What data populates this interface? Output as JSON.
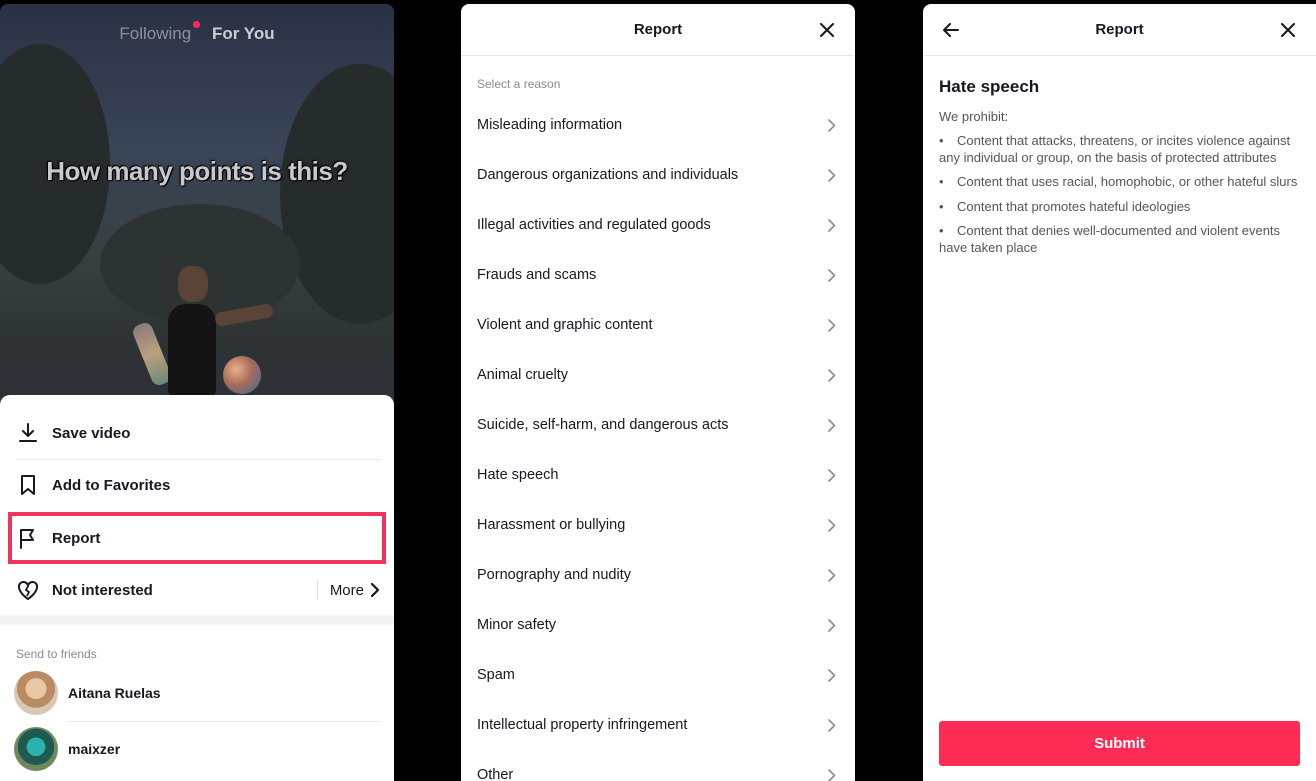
{
  "feed": {
    "tab_following": "Following",
    "tab_for_you": "For You",
    "caption": "How many points is this?"
  },
  "share_sheet": {
    "items": [
      {
        "label": "Save video",
        "icon": "download-icon"
      },
      {
        "label": "Add to Favorites",
        "icon": "bookmark-icon"
      },
      {
        "label": "Report",
        "icon": "flag-icon"
      },
      {
        "label": "Not interested",
        "icon": "broken-heart-icon"
      }
    ],
    "more_label": "More",
    "send_to_friends_title": "Send to friends",
    "friends": [
      {
        "name": "Aitana Ruelas"
      },
      {
        "name": "maixzer"
      }
    ]
  },
  "report_list": {
    "title": "Report",
    "section_title": "Select a reason",
    "reasons": [
      "Misleading information",
      "Dangerous organizations and individuals",
      "Illegal activities and regulated goods",
      "Frauds and scams",
      "Violent and graphic content",
      "Animal cruelty",
      "Suicide, self-harm, and dangerous acts",
      "Hate speech",
      "Harassment or bullying",
      "Pornography and nudity",
      "Minor safety",
      "Spam",
      "Intellectual property infringement",
      "Other"
    ]
  },
  "report_detail": {
    "title": "Report",
    "heading": "Hate speech",
    "intro": "We prohibit:",
    "bullets": [
      "Content that attacks, threatens, or incites violence against any individual or group, on the basis of protected attributes",
      "Content that uses racial, homophobic, or other hateful slurs",
      "Content that promotes hateful ideologies",
      "Content that denies well-documented and violent events have taken place"
    ],
    "submit_label": "Submit"
  },
  "colors": {
    "accent": "#fe2c55",
    "highlight_border": "#f0345f",
    "text_primary": "#161823",
    "text_secondary": "#8a8b91"
  }
}
